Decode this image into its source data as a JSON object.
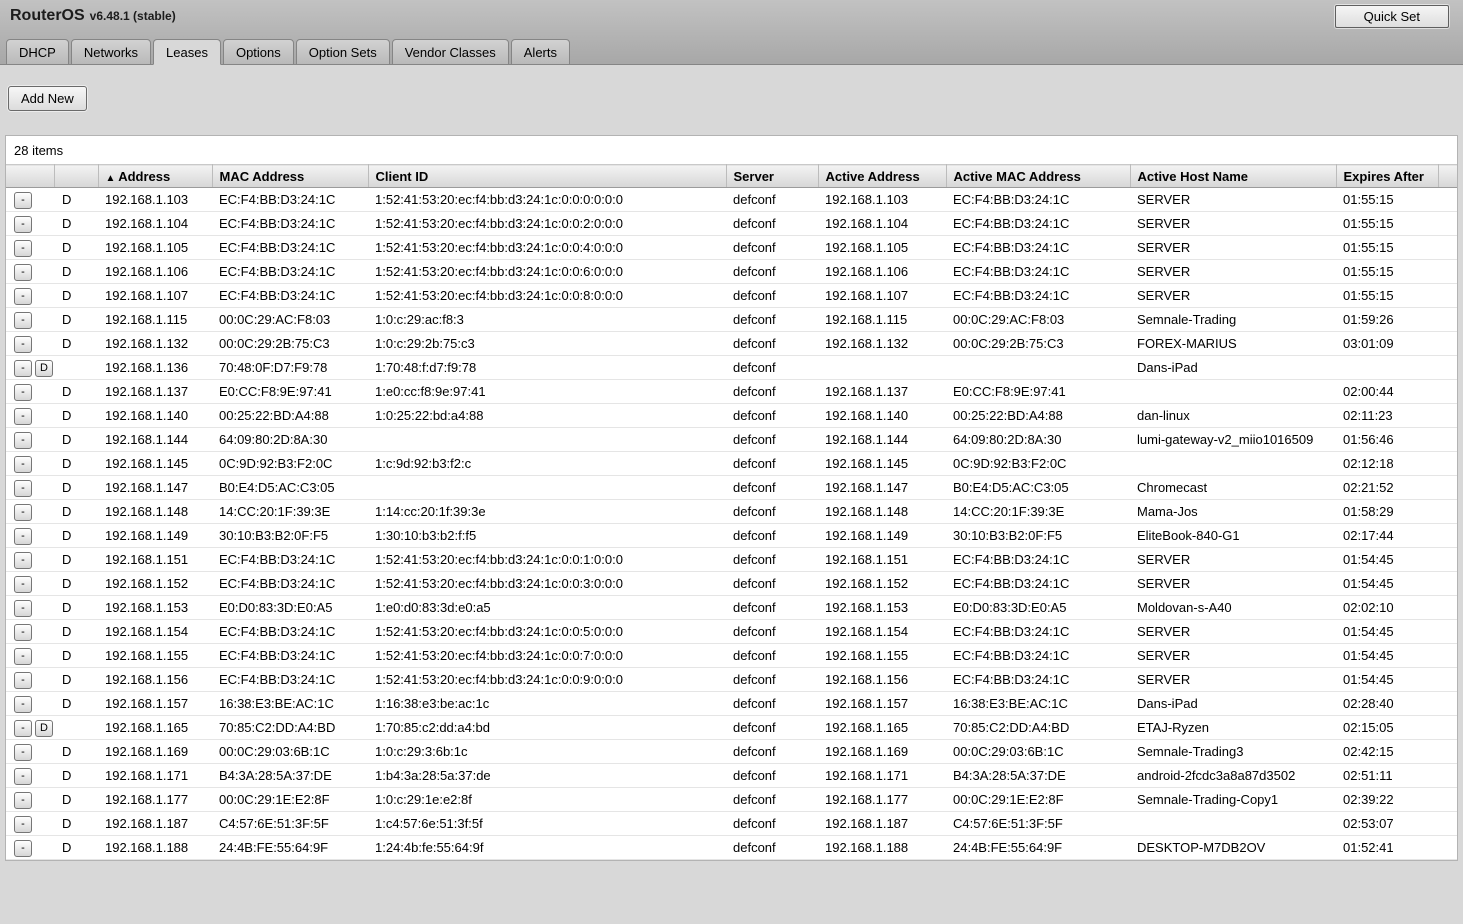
{
  "header": {
    "title": "RouterOS",
    "version": "v6.48.1 (stable)",
    "quick_set_label": "Quick Set"
  },
  "tabs": [
    "DHCP",
    "Networks",
    "Leases",
    "Options",
    "Option Sets",
    "Vendor Classes",
    "Alerts"
  ],
  "active_tab": "Leases",
  "toolbar": {
    "add_new_label": "Add New"
  },
  "items_count": "28 items",
  "table": {
    "columns": [
      "Address",
      "MAC Address",
      "Client ID",
      "Server",
      "Active Address",
      "Active MAC Address",
      "Active Host Name",
      "Expires After"
    ],
    "sort_column": "Address",
    "sort_indicator": "▲",
    "rows": [
      {
        "buttons": [
          "-"
        ],
        "flag": "D",
        "address": "192.168.1.103",
        "mac": "EC:F4:BB:D3:24:1C",
        "client_id": "1:52:41:53:20:ec:f4:bb:d3:24:1c:0:0:0:0:0:0",
        "server": "defconf",
        "active_address": "192.168.1.103",
        "active_mac": "EC:F4:BB:D3:24:1C",
        "host": "SERVER",
        "expires": "01:55:15"
      },
      {
        "buttons": [
          "-"
        ],
        "flag": "D",
        "address": "192.168.1.104",
        "mac": "EC:F4:BB:D3:24:1C",
        "client_id": "1:52:41:53:20:ec:f4:bb:d3:24:1c:0:0:2:0:0:0",
        "server": "defconf",
        "active_address": "192.168.1.104",
        "active_mac": "EC:F4:BB:D3:24:1C",
        "host": "SERVER",
        "expires": "01:55:15"
      },
      {
        "buttons": [
          "-"
        ],
        "flag": "D",
        "address": "192.168.1.105",
        "mac": "EC:F4:BB:D3:24:1C",
        "client_id": "1:52:41:53:20:ec:f4:bb:d3:24:1c:0:0:4:0:0:0",
        "server": "defconf",
        "active_address": "192.168.1.105",
        "active_mac": "EC:F4:BB:D3:24:1C",
        "host": "SERVER",
        "expires": "01:55:15"
      },
      {
        "buttons": [
          "-"
        ],
        "flag": "D",
        "address": "192.168.1.106",
        "mac": "EC:F4:BB:D3:24:1C",
        "client_id": "1:52:41:53:20:ec:f4:bb:d3:24:1c:0:0:6:0:0:0",
        "server": "defconf",
        "active_address": "192.168.1.106",
        "active_mac": "EC:F4:BB:D3:24:1C",
        "host": "SERVER",
        "expires": "01:55:15"
      },
      {
        "buttons": [
          "-"
        ],
        "flag": "D",
        "address": "192.168.1.107",
        "mac": "EC:F4:BB:D3:24:1C",
        "client_id": "1:52:41:53:20:ec:f4:bb:d3:24:1c:0:0:8:0:0:0",
        "server": "defconf",
        "active_address": "192.168.1.107",
        "active_mac": "EC:F4:BB:D3:24:1C",
        "host": "SERVER",
        "expires": "01:55:15"
      },
      {
        "buttons": [
          "-"
        ],
        "flag": "D",
        "address": "192.168.1.115",
        "mac": "00:0C:29:AC:F8:03",
        "client_id": "1:0:c:29:ac:f8:3",
        "server": "defconf",
        "active_address": "192.168.1.115",
        "active_mac": "00:0C:29:AC:F8:03",
        "host": "Semnale-Trading",
        "expires": "01:59:26"
      },
      {
        "buttons": [
          "-"
        ],
        "flag": "D",
        "address": "192.168.1.132",
        "mac": "00:0C:29:2B:75:C3",
        "client_id": "1:0:c:29:2b:75:c3",
        "server": "defconf",
        "active_address": "192.168.1.132",
        "active_mac": "00:0C:29:2B:75:C3",
        "host": "FOREX-MARIUS",
        "expires": "03:01:09"
      },
      {
        "buttons": [
          "-",
          "D"
        ],
        "flag": "",
        "address": "192.168.1.136",
        "mac": "70:48:0F:D7:F9:78",
        "client_id": "1:70:48:f:d7:f9:78",
        "server": "defconf",
        "active_address": "",
        "active_mac": "",
        "host": "Dans-iPad",
        "expires": ""
      },
      {
        "buttons": [
          "-"
        ],
        "flag": "D",
        "address": "192.168.1.137",
        "mac": "E0:CC:F8:9E:97:41",
        "client_id": "1:e0:cc:f8:9e:97:41",
        "server": "defconf",
        "active_address": "192.168.1.137",
        "active_mac": "E0:CC:F8:9E:97:41",
        "host": "",
        "expires": "02:00:44"
      },
      {
        "buttons": [
          "-"
        ],
        "flag": "D",
        "address": "192.168.1.140",
        "mac": "00:25:22:BD:A4:88",
        "client_id": "1:0:25:22:bd:a4:88",
        "server": "defconf",
        "active_address": "192.168.1.140",
        "active_mac": "00:25:22:BD:A4:88",
        "host": "dan-linux",
        "expires": "02:11:23"
      },
      {
        "buttons": [
          "-"
        ],
        "flag": "D",
        "address": "192.168.1.144",
        "mac": "64:09:80:2D:8A:30",
        "client_id": "",
        "server": "defconf",
        "active_address": "192.168.1.144",
        "active_mac": "64:09:80:2D:8A:30",
        "host": "lumi-gateway-v2_miio1016509",
        "expires": "01:56:46"
      },
      {
        "buttons": [
          "-"
        ],
        "flag": "D",
        "address": "192.168.1.145",
        "mac": "0C:9D:92:B3:F2:0C",
        "client_id": "1:c:9d:92:b3:f2:c",
        "server": "defconf",
        "active_address": "192.168.1.145",
        "active_mac": "0C:9D:92:B3:F2:0C",
        "host": "",
        "expires": "02:12:18"
      },
      {
        "buttons": [
          "-"
        ],
        "flag": "D",
        "address": "192.168.1.147",
        "mac": "B0:E4:D5:AC:C3:05",
        "client_id": "",
        "server": "defconf",
        "active_address": "192.168.1.147",
        "active_mac": "B0:E4:D5:AC:C3:05",
        "host": "Chromecast",
        "expires": "02:21:52"
      },
      {
        "buttons": [
          "-"
        ],
        "flag": "D",
        "address": "192.168.1.148",
        "mac": "14:CC:20:1F:39:3E",
        "client_id": "1:14:cc:20:1f:39:3e",
        "server": "defconf",
        "active_address": "192.168.1.148",
        "active_mac": "14:CC:20:1F:39:3E",
        "host": "Mama-Jos",
        "expires": "01:58:29"
      },
      {
        "buttons": [
          "-"
        ],
        "flag": "D",
        "address": "192.168.1.149",
        "mac": "30:10:B3:B2:0F:F5",
        "client_id": "1:30:10:b3:b2:f:f5",
        "server": "defconf",
        "active_address": "192.168.1.149",
        "active_mac": "30:10:B3:B2:0F:F5",
        "host": "EliteBook-840-G1",
        "expires": "02:17:44"
      },
      {
        "buttons": [
          "-"
        ],
        "flag": "D",
        "address": "192.168.1.151",
        "mac": "EC:F4:BB:D3:24:1C",
        "client_id": "1:52:41:53:20:ec:f4:bb:d3:24:1c:0:0:1:0:0:0",
        "server": "defconf",
        "active_address": "192.168.1.151",
        "active_mac": "EC:F4:BB:D3:24:1C",
        "host": "SERVER",
        "expires": "01:54:45"
      },
      {
        "buttons": [
          "-"
        ],
        "flag": "D",
        "address": "192.168.1.152",
        "mac": "EC:F4:BB:D3:24:1C",
        "client_id": "1:52:41:53:20:ec:f4:bb:d3:24:1c:0:0:3:0:0:0",
        "server": "defconf",
        "active_address": "192.168.1.152",
        "active_mac": "EC:F4:BB:D3:24:1C",
        "host": "SERVER",
        "expires": "01:54:45"
      },
      {
        "buttons": [
          "-"
        ],
        "flag": "D",
        "address": "192.168.1.153",
        "mac": "E0:D0:83:3D:E0:A5",
        "client_id": "1:e0:d0:83:3d:e0:a5",
        "server": "defconf",
        "active_address": "192.168.1.153",
        "active_mac": "E0:D0:83:3D:E0:A5",
        "host": "Moldovan-s-A40",
        "expires": "02:02:10"
      },
      {
        "buttons": [
          "-"
        ],
        "flag": "D",
        "address": "192.168.1.154",
        "mac": "EC:F4:BB:D3:24:1C",
        "client_id": "1:52:41:53:20:ec:f4:bb:d3:24:1c:0:0:5:0:0:0",
        "server": "defconf",
        "active_address": "192.168.1.154",
        "active_mac": "EC:F4:BB:D3:24:1C",
        "host": "SERVER",
        "expires": "01:54:45"
      },
      {
        "buttons": [
          "-"
        ],
        "flag": "D",
        "address": "192.168.1.155",
        "mac": "EC:F4:BB:D3:24:1C",
        "client_id": "1:52:41:53:20:ec:f4:bb:d3:24:1c:0:0:7:0:0:0",
        "server": "defconf",
        "active_address": "192.168.1.155",
        "active_mac": "EC:F4:BB:D3:24:1C",
        "host": "SERVER",
        "expires": "01:54:45"
      },
      {
        "buttons": [
          "-"
        ],
        "flag": "D",
        "address": "192.168.1.156",
        "mac": "EC:F4:BB:D3:24:1C",
        "client_id": "1:52:41:53:20:ec:f4:bb:d3:24:1c:0:0:9:0:0:0",
        "server": "defconf",
        "active_address": "192.168.1.156",
        "active_mac": "EC:F4:BB:D3:24:1C",
        "host": "SERVER",
        "expires": "01:54:45"
      },
      {
        "buttons": [
          "-"
        ],
        "flag": "D",
        "address": "192.168.1.157",
        "mac": "16:38:E3:BE:AC:1C",
        "client_id": "1:16:38:e3:be:ac:1c",
        "server": "defconf",
        "active_address": "192.168.1.157",
        "active_mac": "16:38:E3:BE:AC:1C",
        "host": "Dans-iPad",
        "expires": "02:28:40"
      },
      {
        "buttons": [
          "-",
          "D"
        ],
        "flag": "",
        "address": "192.168.1.165",
        "mac": "70:85:C2:DD:A4:BD",
        "client_id": "1:70:85:c2:dd:a4:bd",
        "server": "defconf",
        "active_address": "192.168.1.165",
        "active_mac": "70:85:C2:DD:A4:BD",
        "host": "ETAJ-Ryzen",
        "expires": "02:15:05"
      },
      {
        "buttons": [
          "-"
        ],
        "flag": "D",
        "address": "192.168.1.169",
        "mac": "00:0C:29:03:6B:1C",
        "client_id": "1:0:c:29:3:6b:1c",
        "server": "defconf",
        "active_address": "192.168.1.169",
        "active_mac": "00:0C:29:03:6B:1C",
        "host": "Semnale-Trading3",
        "expires": "02:42:15"
      },
      {
        "buttons": [
          "-"
        ],
        "flag": "D",
        "address": "192.168.1.171",
        "mac": "B4:3A:28:5A:37:DE",
        "client_id": "1:b4:3a:28:5a:37:de",
        "server": "defconf",
        "active_address": "192.168.1.171",
        "active_mac": "B4:3A:28:5A:37:DE",
        "host": "android-2fcdc3a8a87d3502",
        "expires": "02:51:11"
      },
      {
        "buttons": [
          "-"
        ],
        "flag": "D",
        "address": "192.168.1.177",
        "mac": "00:0C:29:1E:E2:8F",
        "client_id": "1:0:c:29:1e:e2:8f",
        "server": "defconf",
        "active_address": "192.168.1.177",
        "active_mac": "00:0C:29:1E:E2:8F",
        "host": "Semnale-Trading-Copy1",
        "expires": "02:39:22"
      },
      {
        "buttons": [
          "-"
        ],
        "flag": "D",
        "address": "192.168.1.187",
        "mac": "C4:57:6E:51:3F:5F",
        "client_id": "1:c4:57:6e:51:3f:5f",
        "server": "defconf",
        "active_address": "192.168.1.187",
        "active_mac": "C4:57:6E:51:3F:5F",
        "host": "",
        "expires": "02:53:07"
      },
      {
        "buttons": [
          "-"
        ],
        "flag": "D",
        "address": "192.168.1.188",
        "mac": "24:4B:FE:55:64:9F",
        "client_id": "1:24:4b:fe:55:64:9f",
        "server": "defconf",
        "active_address": "192.168.1.188",
        "active_mac": "24:4B:FE:55:64:9F",
        "host": "DESKTOP-M7DB2OV",
        "expires": "01:52:41"
      }
    ]
  }
}
